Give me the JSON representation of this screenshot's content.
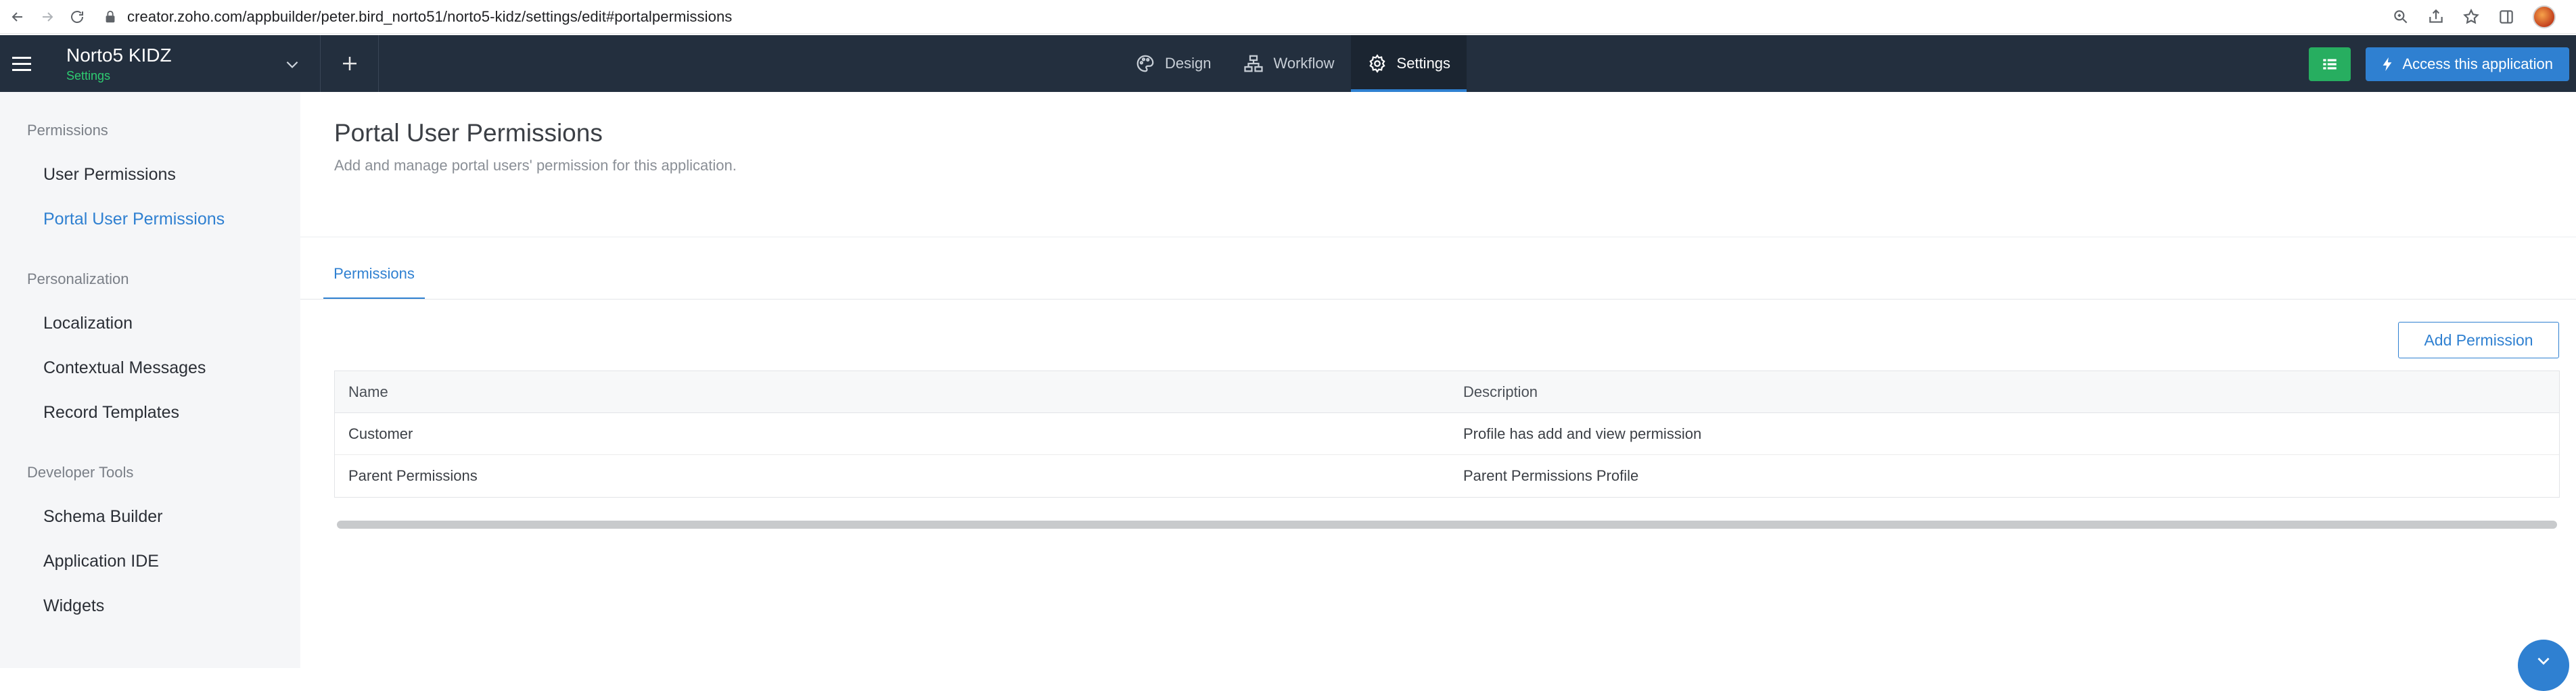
{
  "browser": {
    "url": "creator.zoho.com/appbuilder/peter.bird_norto51/norto5-kidz/settings/edit#portalpermissions"
  },
  "header": {
    "app_title": "Norto5 KIDZ",
    "app_subtitle": "Settings",
    "tabs": [
      {
        "label": "Design",
        "icon": "design-icon",
        "active": false
      },
      {
        "label": "Workflow",
        "icon": "workflow-icon",
        "active": false
      },
      {
        "label": "Settings",
        "icon": "gear-icon",
        "active": true
      }
    ],
    "access_label": "Access this application"
  },
  "sidebar": {
    "groups": [
      {
        "title": "Permissions",
        "items": [
          "User Permissions",
          "Portal User Permissions"
        ]
      },
      {
        "title": "Personalization",
        "items": [
          "Localization",
          "Contextual Messages",
          "Record Templates"
        ]
      },
      {
        "title": "Developer Tools",
        "items": [
          "Schema Builder",
          "Application IDE",
          "Widgets"
        ]
      }
    ],
    "active_item": "Portal User Permissions"
  },
  "main": {
    "title": "Portal User Permissions",
    "description": "Add and manage portal users' permission for this application.",
    "tab": "Permissions",
    "add_button": "Add Permission",
    "table": {
      "columns": [
        "Name",
        "Description"
      ],
      "rows": [
        {
          "name": "Customer",
          "description": "Profile has add and view permission"
        },
        {
          "name": "Parent Permissions",
          "description": "Parent Permissions Profile"
        }
      ]
    }
  },
  "colors": {
    "header_bg": "#232f3e",
    "accent_blue": "#2f80d1",
    "accent_green": "#27ae60",
    "sidebar_bg": "#f5f6f8"
  }
}
